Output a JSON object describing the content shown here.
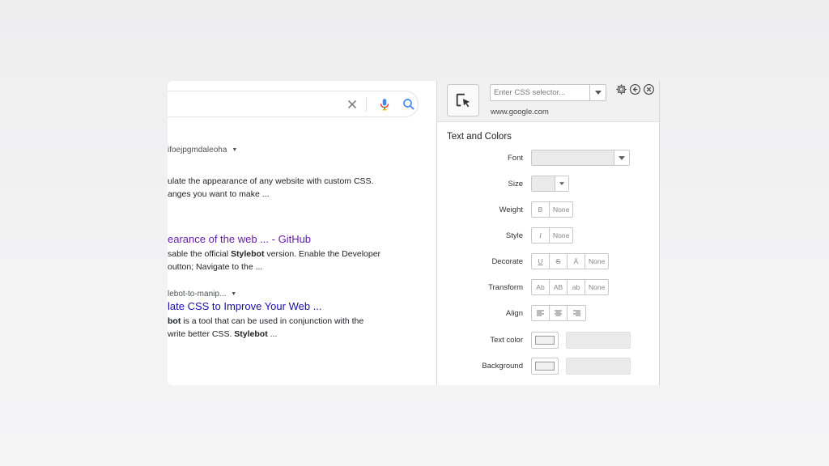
{
  "search": {
    "clear_icon": "close-icon",
    "mic_icon": "microphone-icon",
    "search_icon": "search-icon"
  },
  "results": [
    {
      "url": "ifoejpgmdaleoha",
      "title": "",
      "lines": [
        "ulate the appearance of any website with custom CSS.",
        "anges you want to make ..."
      ]
    },
    {
      "url": "",
      "title": "earance of the web ... - GitHub",
      "lines_html": [
        [
          "sable the official ",
          "Stylebot",
          " version. Enable the Developer"
        ],
        [
          "outton; Navigate to the ...",
          "",
          ""
        ]
      ]
    },
    {
      "url": "lebot-to-manip...",
      "title": "late CSS to Improve Your Web ...",
      "lines_html": [
        [
          "bot",
          " is a tool that can be used in conjunction with the",
          ""
        ],
        [
          " write better CSS. ",
          "Stylebot",
          " ..."
        ]
      ]
    }
  ],
  "panel": {
    "selector_placeholder": "Enter CSS selector...",
    "domain": "www.google.com",
    "section_title": "Text and Colors",
    "labels": {
      "font": "Font",
      "size": "Size",
      "weight": "Weight",
      "style": "Style",
      "decorate": "Decorate",
      "transform": "Transform",
      "align": "Align",
      "text_color": "Text color",
      "background": "Background"
    },
    "weight_options": [
      "B",
      "None"
    ],
    "style_options": [
      "I",
      "None"
    ],
    "decorate_options": [
      "U",
      "S",
      "Ā",
      "None"
    ],
    "transform_options": [
      "Ab",
      "AB",
      "ab",
      "None"
    ],
    "align_options": [
      "align-left-icon",
      "align-center-icon",
      "align-right-icon"
    ],
    "header_icons": [
      "gear-icon",
      "back-icon",
      "close-icon"
    ]
  }
}
